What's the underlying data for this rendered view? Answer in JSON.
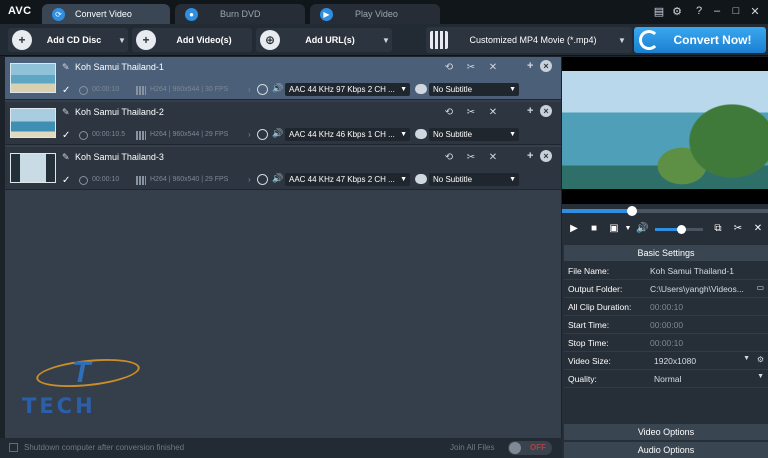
{
  "app": {
    "logo": "AVC"
  },
  "tabs": [
    {
      "label": "Convert Video"
    },
    {
      "label": "Burn DVD"
    },
    {
      "label": "Play Video"
    }
  ],
  "toolbar": {
    "add_cd": "Add CD Disc",
    "add_videos": "Add Video(s)",
    "add_url": "Add URL(s)",
    "format": "Customized MP4 Movie (*.mp4)",
    "convert": "Convert Now!"
  },
  "files": [
    {
      "title": "Koh Samui Thailand-1",
      "duration": "00:00:10",
      "video": "H264 | 960x544 | 30 FPS",
      "audio": "AAC 44 KHz 97 Kbps 2 CH ...",
      "subtitle": "No Subtitle"
    },
    {
      "title": "Koh Samui Thailand-2",
      "duration": "00:00:10.5",
      "video": "H264 | 960x544 | 29 FPS",
      "audio": "AAC 44 KHz 46 Kbps 1 CH ...",
      "subtitle": "No Subtitle"
    },
    {
      "title": "Koh Samui Thailand-3",
      "duration": "00:00:10",
      "video": "H264 | 960x540 | 29 FPS",
      "audio": "AAC 44 KHz 47 Kbps 2 CH ...",
      "subtitle": "No Subtitle"
    }
  ],
  "watermark": {
    "text": "TECH"
  },
  "bottom": {
    "shutdown": "Shutdown computer after conversion finished",
    "join": "Join All Files",
    "toggle": "OFF"
  },
  "player": {
    "seek_fraction": 0.34,
    "volume_fraction": 0.55
  },
  "settings": {
    "header": "Basic Settings",
    "rows": [
      {
        "key": "File Name:",
        "value": "Koh Samui Thailand-1"
      },
      {
        "key": "Output Folder:",
        "value": "C:\\Users\\yangh\\Videos..."
      },
      {
        "key": "All Clip Duration:",
        "value": "00:00:10"
      },
      {
        "key": "Start Time:",
        "value": "00:00:00"
      },
      {
        "key": "Stop Time:",
        "value": "00:00:10"
      },
      {
        "key": "Video Size:",
        "value": "1920x1080"
      },
      {
        "key": "Quality:",
        "value": "Normal"
      }
    ],
    "video_options": "Video Options",
    "audio_options": "Audio Options"
  },
  "colors": {
    "accent": "#2f8ee0",
    "selected_row": "#4b5f78",
    "background": "#1c2229"
  }
}
